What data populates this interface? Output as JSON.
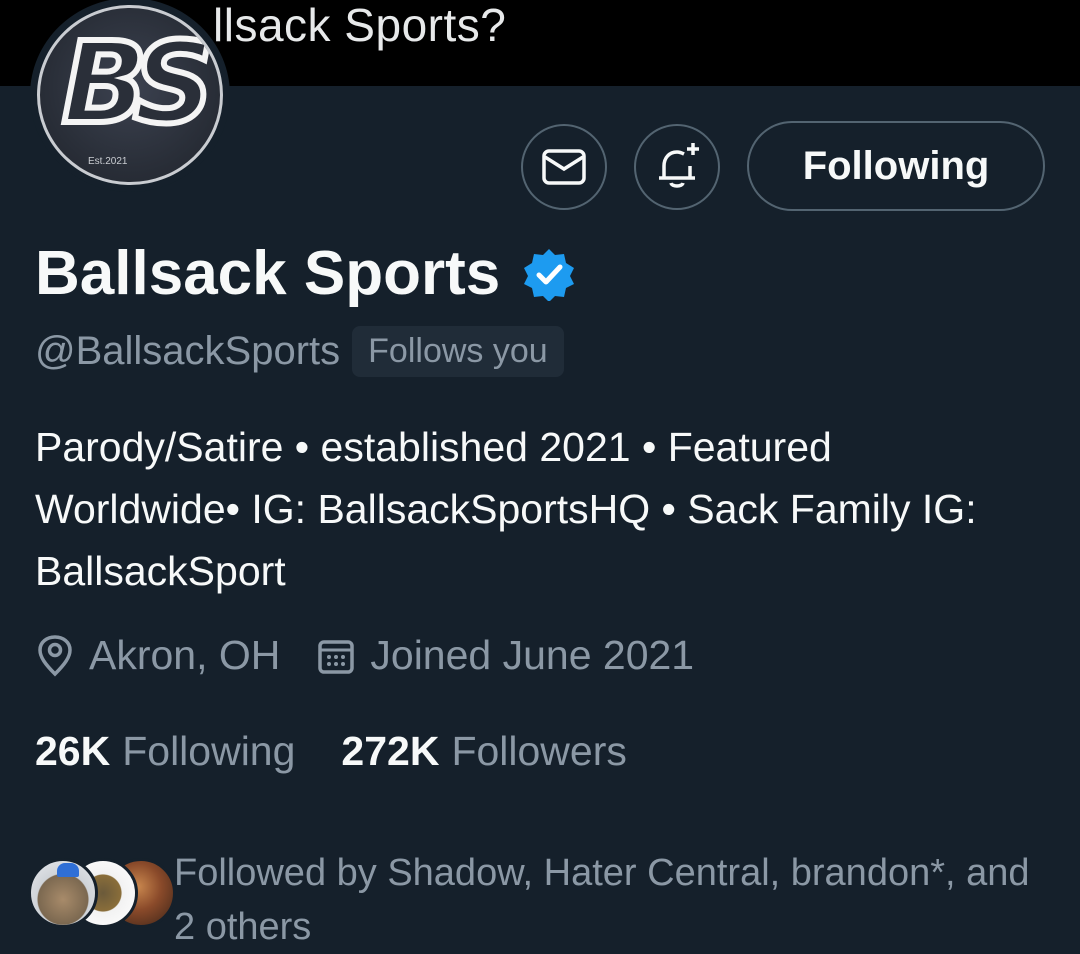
{
  "topbar": {
    "title": "llsack Sports?"
  },
  "profile": {
    "avatar": {
      "logo_text": "BS",
      "est_text": "Est.2021"
    },
    "actions": {
      "message_icon": "mail-icon",
      "notify_icon": "bell-plus-icon",
      "following_label": "Following"
    },
    "display_name": "Ballsack Sports",
    "verified_icon": "verified-badge-icon",
    "handle": "@BallsackSports",
    "follows_you": "Follows you",
    "bio": "Parody/Satire • established 2021 • Featured Worldwide• IG: BallsackSportsHQ • Sack Family IG: BallsackSport",
    "location": "Akron, OH",
    "joined": "Joined June 2021",
    "stats": {
      "following_count": "26K",
      "following_label": "Following",
      "followers_count": "272K",
      "followers_label": "Followers"
    },
    "followed_by": "Followed by Shadow, Hater Central, brandon*, and 2 others"
  },
  "colors": {
    "background": "#15202b",
    "topbar": "#000000",
    "primary_text": "#f7f9f9",
    "secondary_text": "#8b98a5",
    "border": "#536471",
    "verified": "#1d9bf0"
  }
}
